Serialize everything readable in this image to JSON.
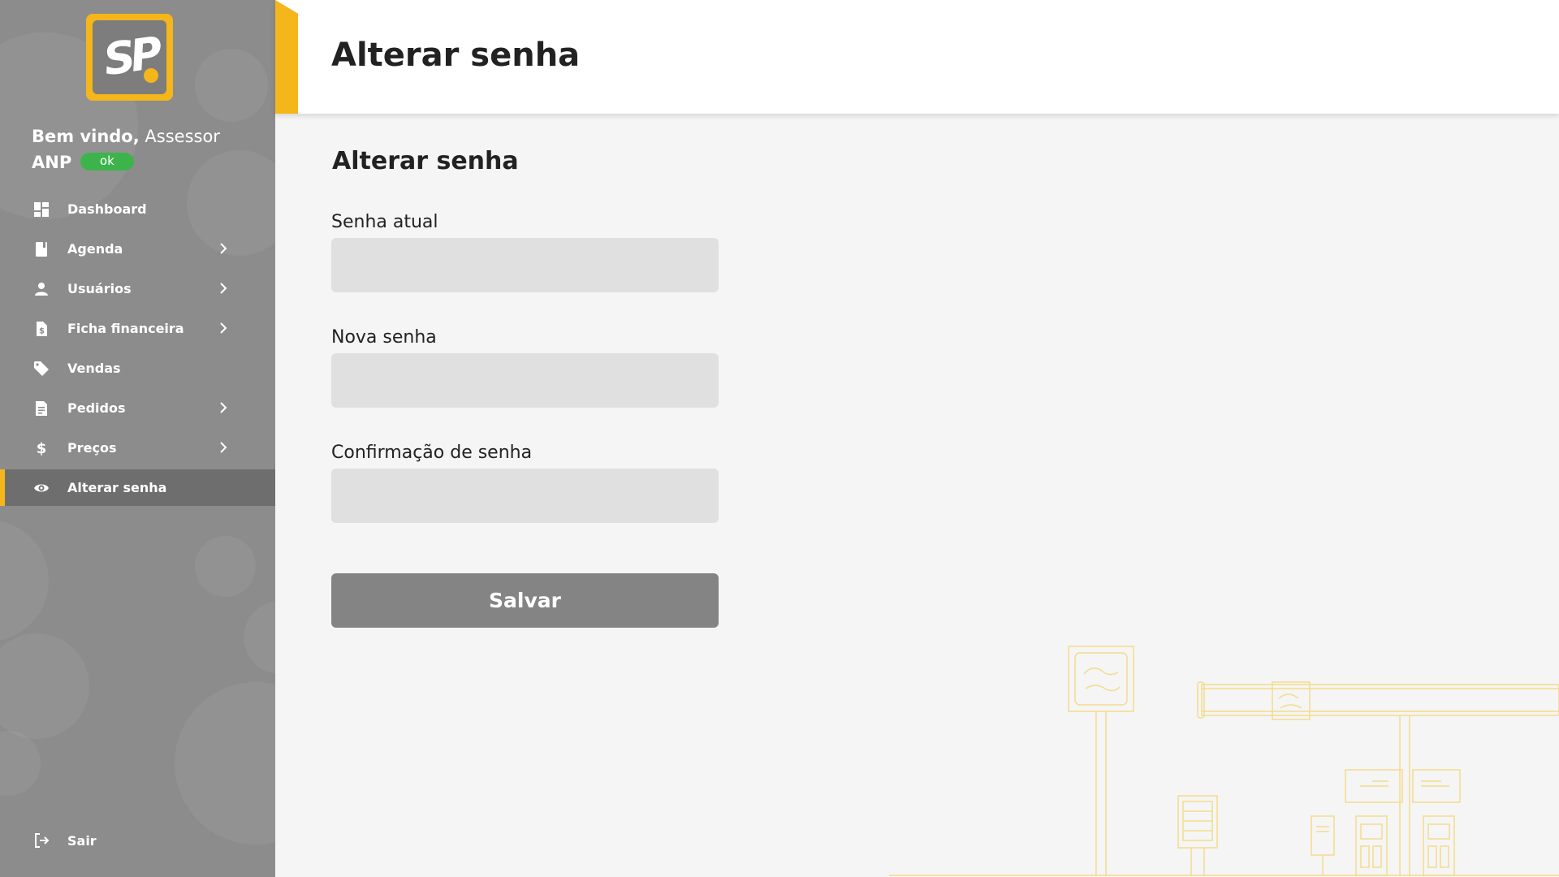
{
  "brand": {
    "logo_text": "SP",
    "accent_color": "#f4b61a",
    "sidebar_color": "#8c8c8c"
  },
  "sidebar": {
    "welcome_bold": "Bem vindo,",
    "welcome_name": "Assessor",
    "welcome_role": "ANP",
    "status_badge": "ok",
    "items": [
      {
        "label": "Dashboard",
        "icon": "dashboard-icon",
        "has_submenu": false
      },
      {
        "label": "Agenda",
        "icon": "book-icon",
        "has_submenu": true
      },
      {
        "label": "Usuários",
        "icon": "user-icon",
        "has_submenu": true
      },
      {
        "label": "Ficha financeira",
        "icon": "invoice-icon",
        "has_submenu": true
      },
      {
        "label": "Vendas",
        "icon": "tag-icon",
        "has_submenu": false
      },
      {
        "label": "Pedidos",
        "icon": "document-icon",
        "has_submenu": true
      },
      {
        "label": "Preços",
        "icon": "dollar-icon",
        "has_submenu": true
      },
      {
        "label": "Alterar senha",
        "icon": "eye-icon",
        "has_submenu": false,
        "active": true
      }
    ],
    "logout_label": "Sair"
  },
  "header": {
    "title": "Alterar senha"
  },
  "form": {
    "title": "Alterar senha",
    "current_password": {
      "label": "Senha atual",
      "value": ""
    },
    "new_password": {
      "label": "Nova senha",
      "value": ""
    },
    "confirm_password": {
      "label": "Confirmação de senha",
      "value": ""
    },
    "save_label": "Salvar"
  }
}
